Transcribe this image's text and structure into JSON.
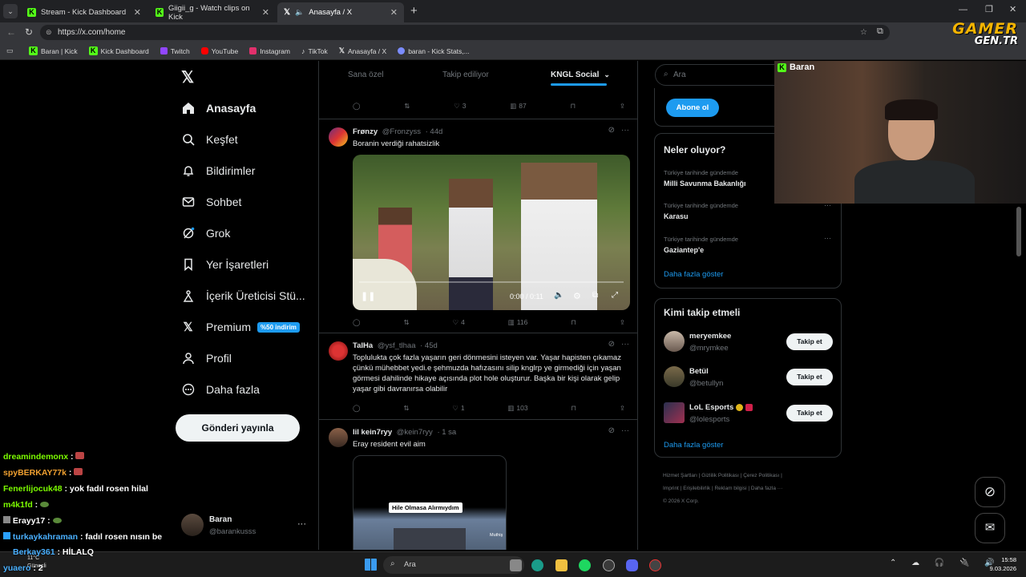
{
  "browser": {
    "tabs": [
      {
        "title": "Stream - Kick Dashboard",
        "favicon": "kick-icon",
        "active": false
      },
      {
        "title": "Giigii_g - Watch clips on Kick",
        "favicon": "kick-icon",
        "active": false
      },
      {
        "title": "Anasayfa / X",
        "favicon": "x-icon",
        "active": true
      }
    ],
    "new_tab": "+",
    "url": "https://x.com/home",
    "bookmarks": [
      {
        "label": "Baran | Kick",
        "icon": "kick-icon",
        "color": "#53fc18"
      },
      {
        "label": "Kick Dashboard",
        "icon": "kick-icon",
        "color": "#53fc18"
      },
      {
        "label": "Twitch",
        "icon": "twitch-icon",
        "color": "#9146ff"
      },
      {
        "label": "YouTube",
        "icon": "youtube-icon",
        "color": "#ff0000"
      },
      {
        "label": "Instagram",
        "icon": "instagram-icon",
        "color": "#e1306c"
      },
      {
        "label": "TikTok",
        "icon": "tiktok-icon",
        "color": "#ffffff"
      },
      {
        "label": "Anasayfa / X",
        "icon": "x-icon",
        "color": "#ffffff"
      },
      {
        "label": "baran - Kick Stats,...",
        "icon": "stats-icon",
        "color": "#7b8cff"
      }
    ]
  },
  "overlay": {
    "logo_top": "GAMER",
    "logo_bottom": "GEN.TR",
    "streamer_label": "Baran",
    "chat": [
      {
        "user": "dreamindemonx",
        "msg": "",
        "color": "#7cfc00",
        "emote": true
      },
      {
        "user": "spyBERKAY77k",
        "msg": "",
        "color": "#f0a030",
        "emote": true
      },
      {
        "user": "Fenerlijocuk48",
        "msg": "yok fadıl rosen hilal",
        "color": "#7cfc00",
        "emote": false
      },
      {
        "user": "m4k1fd",
        "msg": "",
        "color": "#7cfc00",
        "emote": true
      },
      {
        "user": "Erayy17",
        "msg": "",
        "color": "#ffffff",
        "emote": true
      },
      {
        "user": "turkaykahraman",
        "msg": "fadıl rosen nısın be",
        "color": "#4ab0ff",
        "emote": false
      },
      {
        "user": "Berkay361",
        "msg": "HİLALQ",
        "color": "#4ab0ff",
        "emote": false
      },
      {
        "user": "yuaero",
        "msg": "2",
        "color": "#4ab0ff",
        "emote": false
      }
    ]
  },
  "x": {
    "nav": [
      {
        "label": "Anasayfa",
        "icon": "home-icon",
        "bold": true
      },
      {
        "label": "Keşfet",
        "icon": "search-icon"
      },
      {
        "label": "Bildirimler",
        "icon": "bell-icon"
      },
      {
        "label": "Sohbet",
        "icon": "mail-icon"
      },
      {
        "label": "Grok",
        "icon": "grok-icon"
      },
      {
        "label": "Yer İşaretleri",
        "icon": "bookmark-icon"
      },
      {
        "label": "İçerik Üreticisi Stü...",
        "icon": "creator-studio-icon"
      },
      {
        "label": "Premium",
        "icon": "x-premium-icon",
        "badge": "%50 indirim"
      },
      {
        "label": "Profil",
        "icon": "profile-icon"
      },
      {
        "label": "Daha fazla",
        "icon": "more-icon"
      }
    ],
    "post_button": "Gönderi yayınla",
    "account": {
      "name": "Baran",
      "handle": "@barankusss",
      "more": "···"
    },
    "feed_tabs": [
      "Sana özel",
      "Takip ediliyor",
      "KNGL Social"
    ],
    "top_actions": {
      "likes": "3",
      "views": "87"
    },
    "tweets": [
      {
        "name": "Frønzy",
        "handle": "@Fronzyss",
        "time": "· 44d",
        "text": "Boranin verdiği rahatsizlik",
        "video_time": "0:00 / 0:11",
        "likes": "4",
        "views": "116"
      },
      {
        "name": "TalHa",
        "handle": "@ysf_tlhaa",
        "time": "· 45d",
        "text": "Toplulukta çok fazla yaşarın geri dönmesini isteyen var. Yaşar hapisten çıkamaz çünkü mühebbet yedi.e şehmuzda hafızasını silip knglrp ye girmediği için yaşan görmesi dahilinde hikaye açısında plot hole oluşturur. Başka bir kişi olarak gelip yaşar gibi davranırsa olabilir",
        "replies": "",
        "retweets": "",
        "likes": "1",
        "views": "103"
      },
      {
        "name": "lil kein7ryy",
        "handle": "@kein7ryy",
        "time": "· 1 sa",
        "text": "Eray resident evil aim",
        "image_caption": "Hile Olmasa Alırmıydım",
        "image_sub": "Muthiş"
      }
    ],
    "search_placeholder": "Ara",
    "subscribe_button": "Abone ol",
    "trends_title": "Neler oluyor?",
    "trends": [
      {
        "context": "Türkiye tarihinde gündemde",
        "topic": "Milli Savunma Bakanlığı"
      },
      {
        "context": "Türkiye tarihinde gündemde",
        "topic": "Karasu"
      },
      {
        "context": "Türkiye tarihinde gündemde",
        "topic": "Gaziantep'e"
      }
    ],
    "show_more": "Daha fazla göster",
    "who_title": "Kimi takip etmeli",
    "suggestions": [
      {
        "name": "meryemkee",
        "handle": "@mrymkee",
        "button": "Takip et"
      },
      {
        "name": "Betül",
        "handle": "@betullyn",
        "button": "Takip et"
      },
      {
        "name": "LoL Esports",
        "handle": "@lolesports",
        "button": "Takip et"
      }
    ],
    "footer": [
      "Hizmet Şartları",
      "Gizlilik Politikası",
      "Çerez Politikası",
      "Imprint",
      "Erişilebilirlik",
      "Reklam bilgisi",
      "Daha fazla ···",
      "© 2026 X Corp."
    ]
  },
  "taskbar": {
    "search": "Ara",
    "weather_temp": "11°C",
    "weather_desc": "Güneşli",
    "time": "15:58",
    "date": "9.03.2026"
  }
}
